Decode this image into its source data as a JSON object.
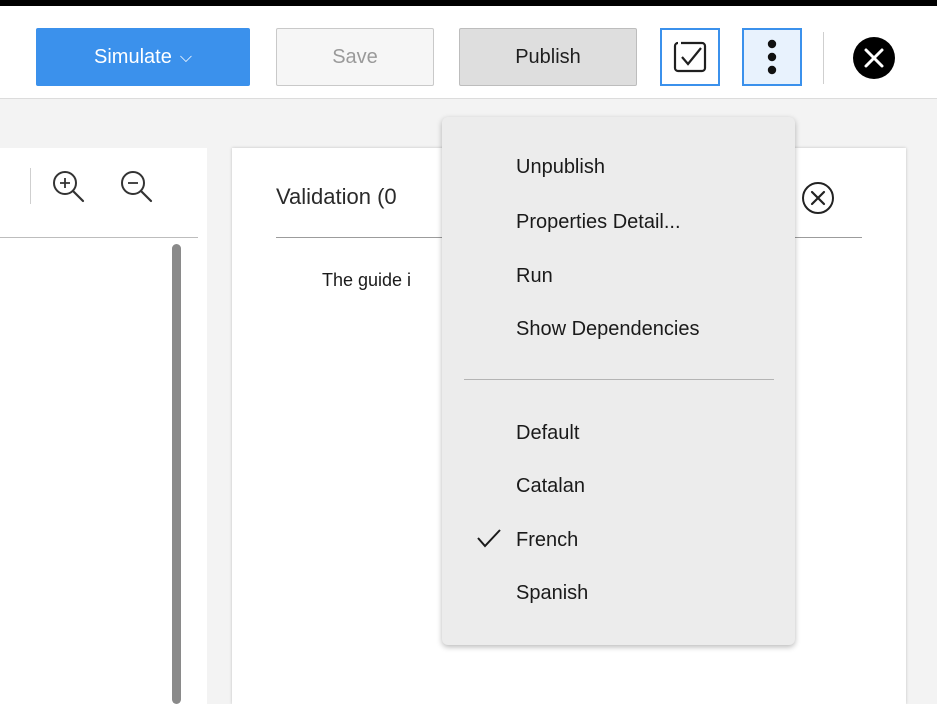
{
  "toolbar": {
    "simulate_label": "Simulate",
    "simulate_chevron": "⌵",
    "save_label": "Save",
    "publish_label": "Publish",
    "icons": [
      "validate-icon",
      "more-vertical-icon",
      "close-icon"
    ],
    "colors": {
      "accent": "#3b91ec",
      "close_bg": "#000000"
    }
  },
  "canvas_tools": {
    "zoom_in_icon": "zoom-in-icon",
    "zoom_out_icon": "zoom-out-icon"
  },
  "validation_panel": {
    "title": "Validation (0",
    "message": "The guide i",
    "close_icon": "close-circle-icon"
  },
  "menu": {
    "actions": [
      {
        "label": "Unpublish"
      },
      {
        "label": "Properties Detail..."
      },
      {
        "label": "Run"
      },
      {
        "label": "Show Dependencies"
      }
    ],
    "languages": [
      {
        "label": "Default",
        "checked": false
      },
      {
        "label": "Catalan",
        "checked": false
      },
      {
        "label": "French",
        "checked": true
      },
      {
        "label": "Spanish",
        "checked": false
      }
    ],
    "check_icon": "checkmark-icon"
  }
}
